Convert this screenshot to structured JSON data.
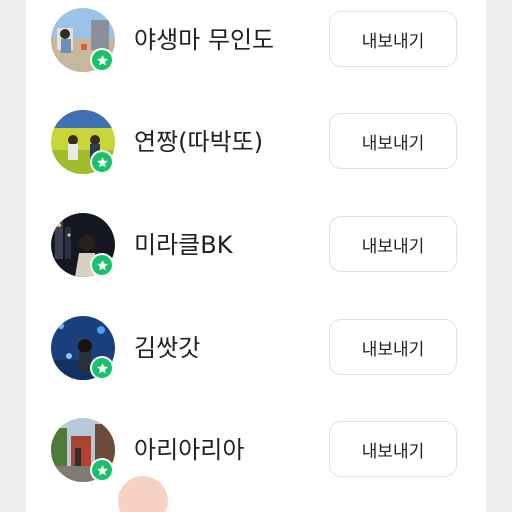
{
  "export_label": "내보내기",
  "users": [
    {
      "name": "야생마 무인도",
      "badge_icon": "star-icon"
    },
    {
      "name": "연짱(따박또)",
      "badge_icon": "star-icon"
    },
    {
      "name": "미라클BK",
      "badge_icon": "star-icon"
    },
    {
      "name": "김쌋갓",
      "badge_icon": "star-icon"
    },
    {
      "name": "아리아리아",
      "badge_icon": "star-icon"
    }
  ],
  "colors": {
    "badge_green": "#18c26b",
    "button_border": "#e2e2e6",
    "page_bg": "#efeff1"
  }
}
